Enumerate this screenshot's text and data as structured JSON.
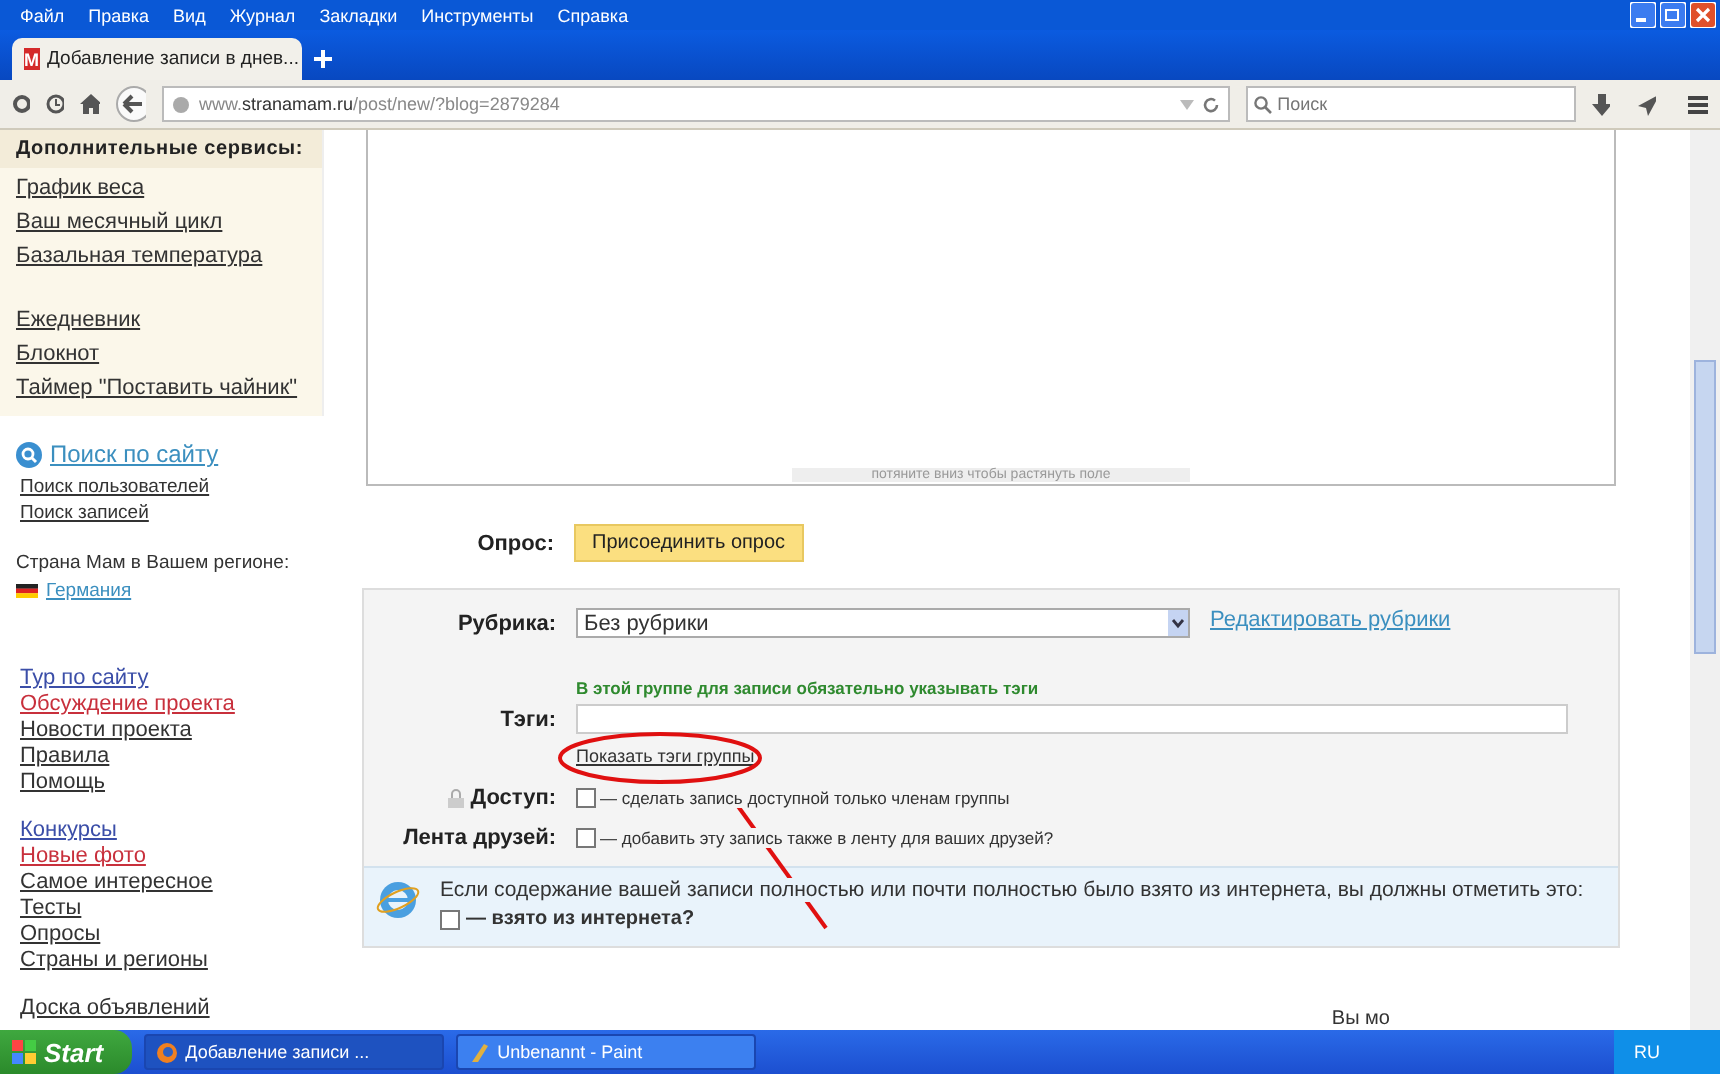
{
  "menu_bar": [
    "Файл",
    "Правка",
    "Вид",
    "Журнал",
    "Закладки",
    "Инструменты",
    "Справка"
  ],
  "tabs": [
    {
      "label": "Добавление записи в днев...",
      "icon_text": "M",
      "selected": true
    }
  ],
  "address_bar": {
    "value": "www.**stranamam.ru**/post/new/?blog=2879284"
  },
  "search": {
    "placeholder": "Поиск"
  },
  "sidebar": {
    "services_title": "Дополнительные сервисы:",
    "service_groups": [
      [
        "График веса",
        "Ваш месячный цикл",
        "Базальная температура"
      ],
      [
        "Ежедневник",
        "Блокнот",
        "Таймер \"Поставить чайник\""
      ]
    ],
    "site_search": "Поиск по сайту",
    "search_links": [
      "Поиск пользователей",
      "Поиск записей"
    ],
    "region_label": "Страна Мам в Вашем регионе:",
    "region": "Германия",
    "link_groups": [
      [
        {
          "label": "Тур по сайту",
          "color": "#3b4ea8"
        },
        {
          "label": "Обсуждение проекта",
          "color": "#c8303c"
        },
        {
          "label": "Новости проекта",
          "color": "#333333"
        },
        {
          "label": "Правила",
          "color": "#333333"
        },
        {
          "label": "Помощь",
          "color": "#333333"
        }
      ],
      [
        {
          "label": "Конкурсы",
          "color": "#3b4ea8"
        },
        {
          "label": "Новые фото",
          "color": "#c8303c"
        },
        {
          "label": "Самое интересное",
          "color": "#333333"
        },
        {
          "label": "Тесты",
          "color": "#333333"
        },
        {
          "label": "Опросы",
          "color": "#333333"
        },
        {
          "label": "Страны и регионы",
          "color": "#333333"
        }
      ],
      [
        {
          "label": "Доска объявлений",
          "color": "#333333"
        }
      ]
    ]
  },
  "editor": {
    "resize_hint": "потяните вниз чтобы растянуть поле"
  },
  "poll": {
    "label": "Опрос:",
    "button": "Присоединить опрос"
  },
  "form": {
    "category": {
      "label": "Рубрика:",
      "value": "Без рубрики",
      "link": "Редактировать рубрики"
    },
    "tags_notice": "В этой группе для записи обязательно указывать тэги",
    "tags": {
      "label": "Тэги:",
      "link": "Показать тэги группы"
    },
    "options": [
      {
        "label": "Доступ:",
        "locked": true,
        "checked": false,
        "text": "— сделать запись доступной только членам группы"
      },
      {
        "label": "Лента друзей:",
        "locked": false,
        "checked": false,
        "text": "— добавить эту запись также в ленту для ваших друзей?"
      }
    ],
    "notice": {
      "text": "Если содержание вашей записи полностью или почти полностью было взято из интернета, вы должны отметить это:",
      "checkbox_label": "— взято из интернета?",
      "checked": false
    }
  },
  "footer_text": "Вы мо",
  "taskbar": {
    "start": "Start",
    "tasks": [
      {
        "label": "Добавление записи ...",
        "kind": "browser",
        "selected": true
      },
      {
        "label": "Unbenannt - Paint",
        "kind": "paint",
        "selected": false
      }
    ],
    "language": "RU"
  }
}
